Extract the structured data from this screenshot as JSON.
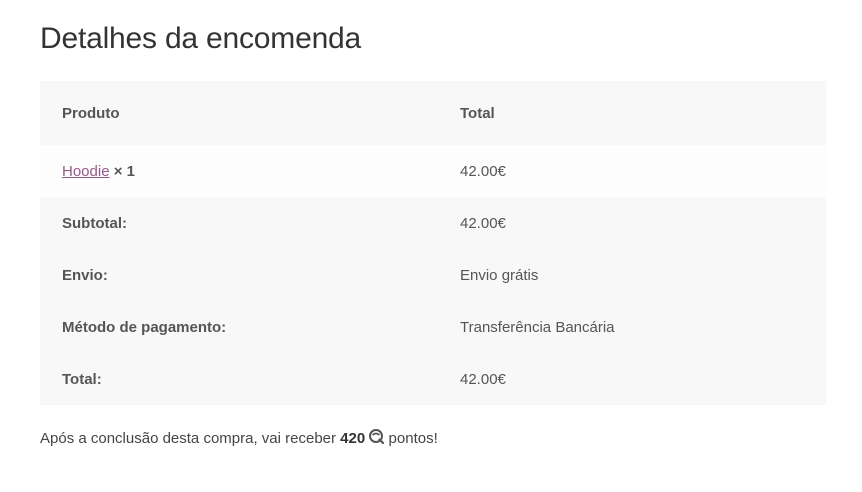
{
  "page": {
    "title": "Detalhes da encomenda"
  },
  "table": {
    "header": {
      "product": "Produto",
      "total": "Total"
    },
    "items": [
      {
        "name": "Hoodie",
        "quantity": "× 1",
        "total": "42.00€"
      }
    ],
    "footer": [
      {
        "label": "Subtotal:",
        "value": "42.00€"
      },
      {
        "label": "Envio:",
        "value": "Envio grátis"
      },
      {
        "label": "Método de pagamento:",
        "value": "Transferência Bancária"
      },
      {
        "label": "Total:",
        "value": "42.00€"
      }
    ]
  },
  "points": {
    "prefix": "Após a conclusão desta compra, vai receber",
    "amount": "420",
    "suffix": "pontos!",
    "icon": "points-icon"
  },
  "colors": {
    "link": "#96588a",
    "table_bg": "#f8f8f8"
  }
}
